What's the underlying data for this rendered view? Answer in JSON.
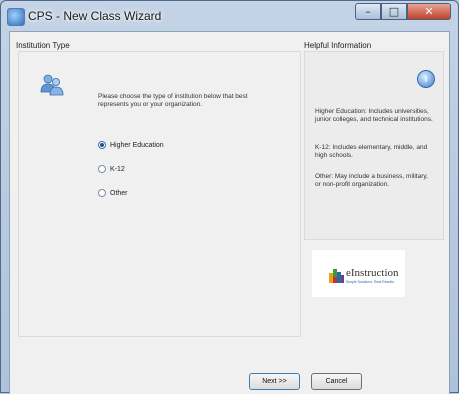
{
  "window": {
    "title": "CPS - New Class Wizard"
  },
  "institution": {
    "heading": "Institution Type",
    "prompt": "Please choose the type of institution below that best represents you or your organization.",
    "options": [
      {
        "label": "Higher Education",
        "selected": true
      },
      {
        "label": "K-12",
        "selected": false
      },
      {
        "label": "Other",
        "selected": false
      }
    ]
  },
  "help": {
    "heading": "Helpful Information",
    "paragraphs": [
      "Higher Education:  Includes universities, junior colleges, and technical institutions.",
      "K-12:  Includes elementary, middle, and high schools.",
      "Other:  May include a business, military, or non-profit organization."
    ]
  },
  "logo": {
    "name": "eInstruction",
    "tagline": "Simple Solutions. Real Results."
  },
  "buttons": {
    "next": "Next >>",
    "cancel": "Cancel"
  },
  "colors": {
    "accent": "#3c7fd1",
    "close": "#c2402a"
  },
  "icons": {
    "app": "app-icon",
    "info": "info-icon",
    "users": "users-icon"
  }
}
